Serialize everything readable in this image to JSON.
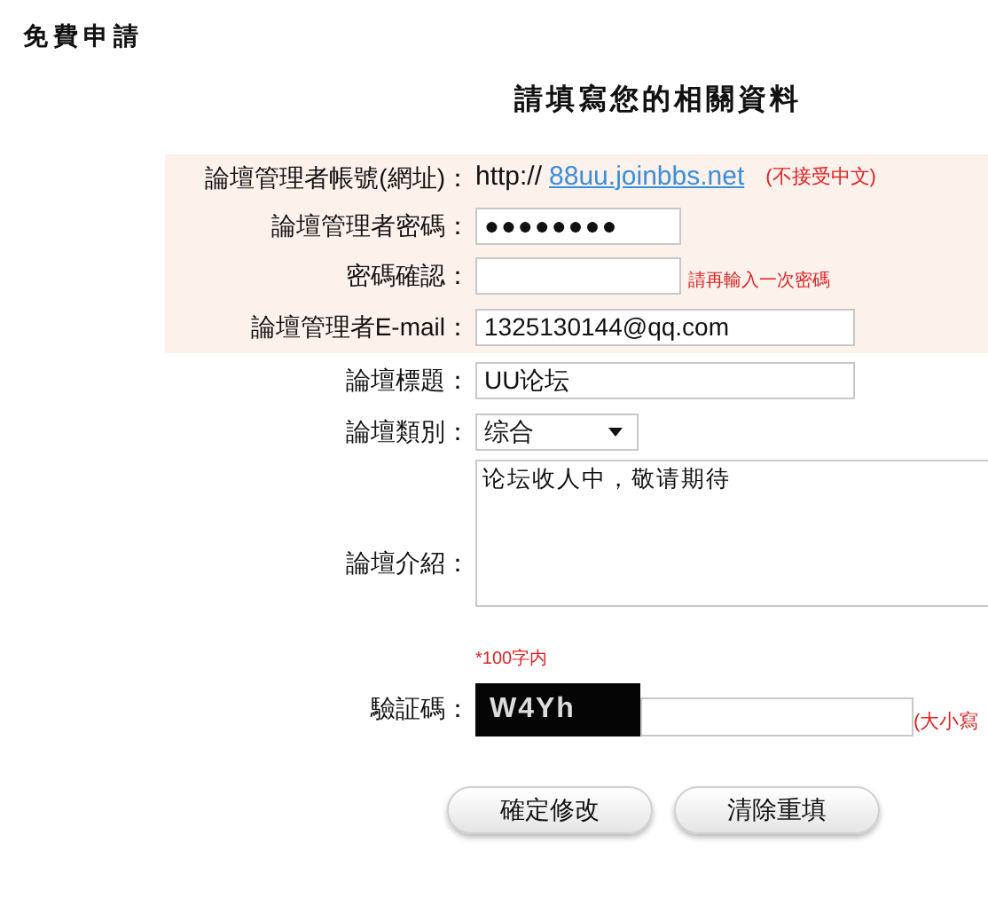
{
  "page_title": "免費申請",
  "form_title": "請填寫您的相關資料",
  "fields": [
    {
      "kind": "url",
      "label": "論壇管理者帳號(網址)：",
      "prefix": "http://",
      "value": "88uu.joinbbs.net",
      "note": "(不接受中文)",
      "highlighted": true
    },
    {
      "kind": "password",
      "label": "論壇管理者密碼：",
      "value": "●●●●●●●●",
      "highlighted": true
    },
    {
      "kind": "password",
      "label": "密碼確認：",
      "note": "請再輸入一次密碼",
      "highlighted": true
    },
    {
      "kind": "text",
      "label": "論壇管理者E-mail：",
      "value": "1325130144@qq.com",
      "highlighted": true
    },
    {
      "kind": "text",
      "label": "論壇標題：",
      "value": "UU论坛",
      "highlighted": false
    },
    {
      "kind": "select",
      "label": "論壇類別：",
      "value": "综合",
      "highlighted": false
    },
    {
      "kind": "textarea",
      "label": "論壇介紹：",
      "value": "论坛收人中，敬请期待",
      "note": "*100字内",
      "highlighted": false
    },
    {
      "kind": "captcha",
      "label": "驗証碼：",
      "captcha": "W4Yh",
      "note": "(大小寫",
      "highlighted": false
    }
  ],
  "buttons": [
    "確定修改",
    "清除重填"
  ]
}
